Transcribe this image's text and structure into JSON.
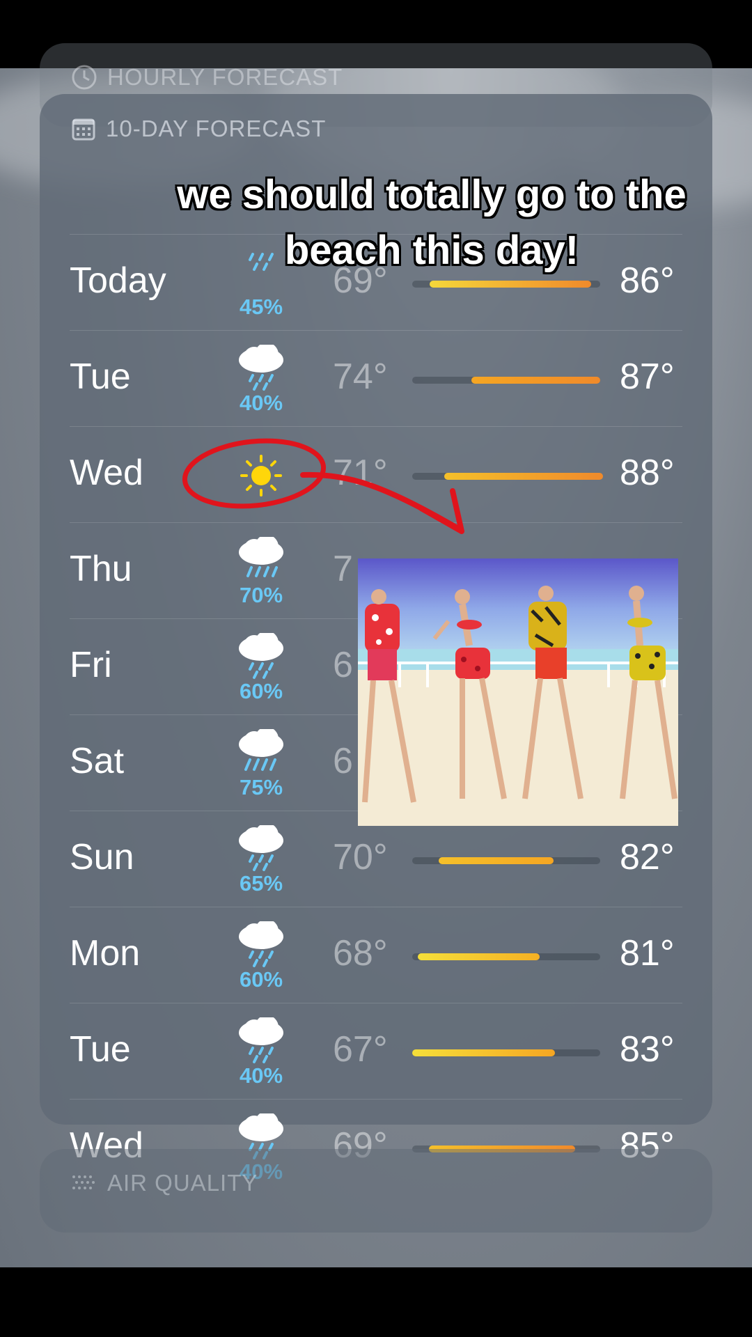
{
  "hourly": {
    "title": "HOURLY FORECAST",
    "icon": "clock-icon"
  },
  "forecast": {
    "title": "10-DAY FORECAST",
    "icon": "calendar-icon",
    "days": [
      {
        "day": "Today",
        "icon": "rain-cloud-icon",
        "precip": "45%",
        "low": "69°",
        "high": "86°"
      },
      {
        "day": "Tue",
        "icon": "rain-cloud-icon",
        "precip": "40%",
        "low": "74°",
        "high": "87°"
      },
      {
        "day": "Wed",
        "icon": "sun-icon",
        "precip": "",
        "low": "71°",
        "high": "88°"
      },
      {
        "day": "Thu",
        "icon": "rain-cloud-icon",
        "precip": "70%",
        "low": "7",
        "high": ""
      },
      {
        "day": "Fri",
        "icon": "rain-cloud-icon",
        "precip": "60%",
        "low": "6",
        "high": ""
      },
      {
        "day": "Sat",
        "icon": "heavy-rain-cloud-icon",
        "precip": "75%",
        "low": "6",
        "high": ""
      },
      {
        "day": "Sun",
        "icon": "rain-cloud-icon",
        "precip": "65%",
        "low": "70°",
        "high": "82°"
      },
      {
        "day": "Mon",
        "icon": "rain-cloud-icon",
        "precip": "60%",
        "low": "68°",
        "high": "81°"
      },
      {
        "day": "Tue",
        "icon": "rain-cloud-icon",
        "precip": "40%",
        "low": "67°",
        "high": "83°"
      },
      {
        "day": "Wed",
        "icon": "rain-cloud-icon",
        "precip": "40%",
        "low": "69°",
        "high": "85°"
      }
    ]
  },
  "air_quality": {
    "title": "AIR QUALITY",
    "icon": "air-quality-icon"
  },
  "caption": {
    "text": "we should totally go to the beach this day!"
  },
  "colors": {
    "precip": "#6ac8f5",
    "bar_start": "#f5d73a",
    "bar_end": "#f08a2b",
    "annotation": "#e0141c"
  }
}
